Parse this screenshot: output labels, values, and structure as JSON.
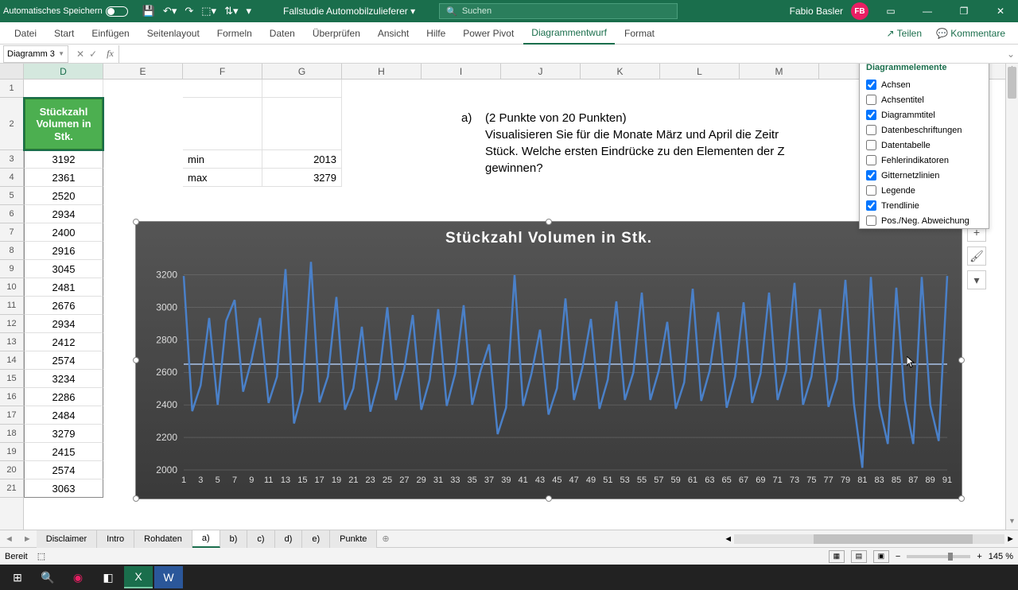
{
  "titlebar": {
    "autosave": "Automatisches Speichern",
    "docname": "Fallstudie Automobilzulieferer",
    "search_placeholder": "Suchen",
    "user": "Fabio Basler",
    "initials": "FB"
  },
  "ribbon": {
    "tabs": [
      "Datei",
      "Start",
      "Einfügen",
      "Seitenlayout",
      "Formeln",
      "Daten",
      "Überprüfen",
      "Ansicht",
      "Hilfe",
      "Power Pivot",
      "Diagrammentwurf",
      "Format"
    ],
    "active": 10,
    "share": "Teilen",
    "comments": "Kommentare"
  },
  "namebox": "Diagramm 3",
  "columns": [
    "D",
    "E",
    "F",
    "G",
    "H",
    "I",
    "J",
    "K",
    "L",
    "M"
  ],
  "data_header": "Stückzahl Volumen in Stk.",
  "data_values": [
    3192,
    2361,
    2520,
    2934,
    2400,
    2916,
    3045,
    2481,
    2676,
    2934,
    2412,
    2574,
    3234,
    2286,
    2484,
    3279,
    2415,
    2574,
    3063
  ],
  "stats": {
    "min_label": "min",
    "min_val": "2013",
    "max_label": "max",
    "max_val": "3279"
  },
  "task": {
    "a": "a)",
    "pts": "(2 Punkte von 20 Punkten)",
    "l1": "Visualisieren Sie für die Monate März und April die Zeitr",
    "l2": "Stück. Welche ersten Eindrücke zu den Elementen der Z",
    "l3": "gewinnen?"
  },
  "chart_data": {
    "type": "line",
    "title": "Stückzahl Volumen in Stk.",
    "ylabel": "",
    "xlabel": "",
    "ylim": [
      2000,
      3300
    ],
    "yticks": [
      2000,
      2200,
      2400,
      2600,
      2800,
      3000,
      3200
    ],
    "x": [
      1,
      2,
      3,
      4,
      5,
      6,
      7,
      8,
      9,
      10,
      11,
      12,
      13,
      14,
      15,
      16,
      17,
      18,
      19,
      20,
      21,
      22,
      23,
      24,
      25,
      26,
      27,
      28,
      29,
      30,
      31,
      32,
      33,
      34,
      35,
      36,
      37,
      38,
      39,
      40,
      41,
      42,
      43,
      44,
      45,
      46,
      47,
      48,
      49,
      50,
      51,
      52,
      53,
      54,
      55,
      56,
      57,
      58,
      59,
      60,
      61,
      62,
      63,
      64,
      65,
      66,
      67,
      68,
      69,
      70,
      71,
      72,
      73,
      74,
      75,
      76,
      77,
      78,
      79,
      80,
      81,
      82,
      83,
      84,
      85,
      86,
      87,
      88,
      89,
      90,
      91
    ],
    "xticks": [
      1,
      3,
      5,
      7,
      9,
      11,
      13,
      15,
      17,
      19,
      21,
      23,
      25,
      27,
      29,
      31,
      33,
      35,
      37,
      39,
      41,
      43,
      45,
      47,
      49,
      51,
      53,
      55,
      57,
      59,
      61,
      63,
      65,
      67,
      69,
      71,
      73,
      75,
      77,
      79,
      81,
      83,
      85,
      87,
      89,
      91
    ],
    "values": [
      3192,
      2361,
      2520,
      2934,
      2400,
      2916,
      3045,
      2481,
      2676,
      2934,
      2412,
      2574,
      3234,
      2286,
      2484,
      3279,
      2415,
      2574,
      3063,
      2370,
      2502,
      2880,
      2358,
      2556,
      3000,
      2430,
      2622,
      2952,
      2370,
      2556,
      2988,
      2394,
      2592,
      3012,
      2400,
      2610,
      2772,
      2220,
      2382,
      3198,
      2394,
      2592,
      2862,
      2340,
      2502,
      3054,
      2430,
      2628,
      2928,
      2376,
      2556,
      3036,
      2430,
      2598,
      3090,
      2430,
      2610,
      2910,
      2376,
      2538,
      3114,
      2424,
      2610,
      2970,
      2382,
      2574,
      3030,
      2412,
      2592,
      3090,
      2430,
      2610,
      3150,
      2400,
      2574,
      2988,
      2388,
      2556,
      3168,
      2406,
      2013,
      3186,
      2394,
      2160,
      3120,
      2430,
      2160,
      3186,
      2400,
      2178,
      3192
    ],
    "trend": 2650
  },
  "chart_elements": {
    "title": "Diagrammelemente",
    "items": [
      {
        "label": "Achsen",
        "checked": true
      },
      {
        "label": "Achsentitel",
        "checked": false
      },
      {
        "label": "Diagrammtitel",
        "checked": true
      },
      {
        "label": "Datenbeschriftungen",
        "checked": false
      },
      {
        "label": "Datentabelle",
        "checked": false
      },
      {
        "label": "Fehlerindikatoren",
        "checked": false
      },
      {
        "label": "Gitternetzlinien",
        "checked": true
      },
      {
        "label": "Legende",
        "checked": false
      },
      {
        "label": "Trendlinie",
        "checked": true
      },
      {
        "label": "Pos./Neg. Abweichung",
        "checked": false
      }
    ]
  },
  "sheets": [
    "Disclaimer",
    "Intro",
    "Rohdaten",
    "a)",
    "b)",
    "c)",
    "d)",
    "e)",
    "Punkte"
  ],
  "active_sheet": 3,
  "status": {
    "ready": "Bereit",
    "zoom": "145 %"
  }
}
